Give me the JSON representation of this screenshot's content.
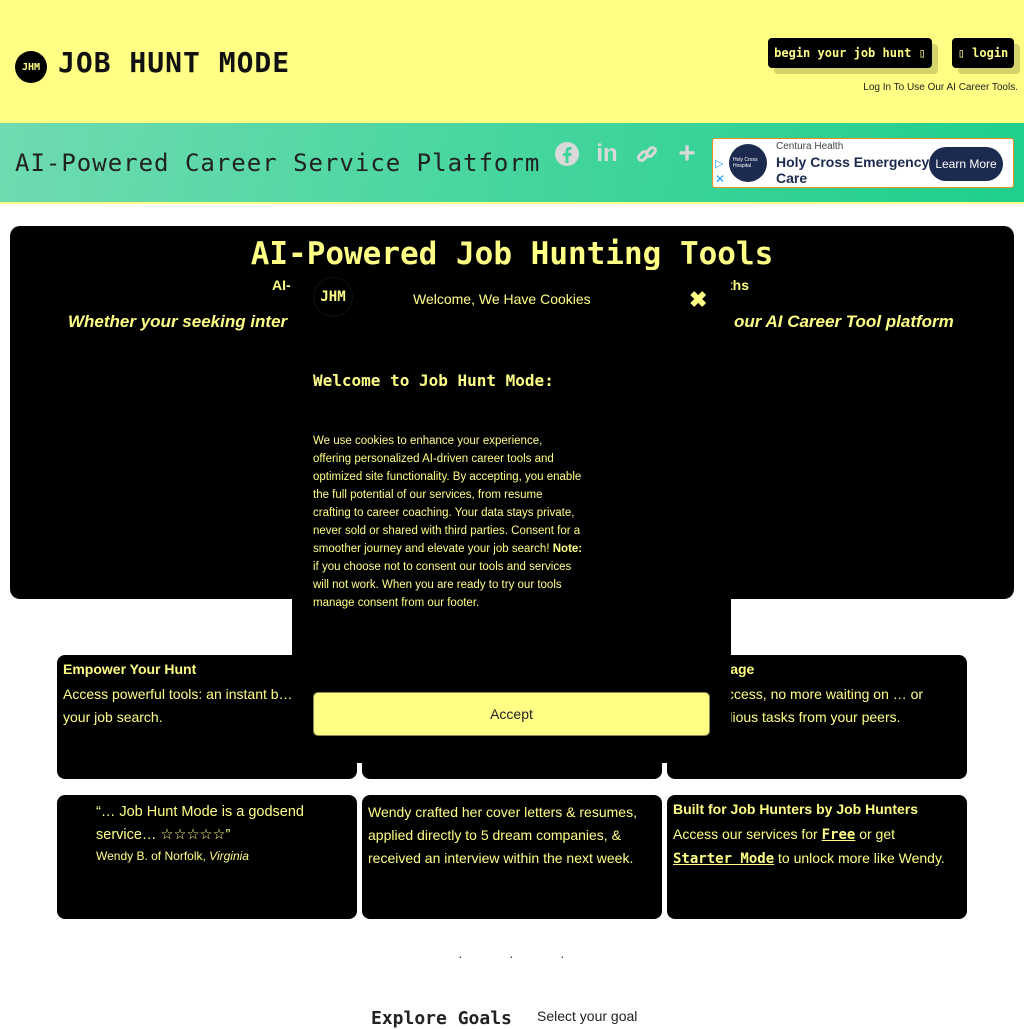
{
  "header": {
    "logo_text": "JHM",
    "brand": "JOB HUNT MODE",
    "begin_button": "begin your job hunt ▯",
    "login_button": "▯ login",
    "login_note": "Log In To Use Our AI Career Tools."
  },
  "banner": {
    "tagline": "AI-Powered Career Service Platform",
    "share_icons": [
      "facebook-icon",
      "linkedin-icon",
      "link-icon",
      "plus-icon"
    ]
  },
  "ad": {
    "logo_text": "Holy Cross Hospital",
    "sponsor": "Centura Health",
    "title": "Holy Cross Emergency Care",
    "cta": "Learn More",
    "play_icon": "▷",
    "close_icon": "✕"
  },
  "hero": {
    "title": "AI-Powered Job Hunting Tools",
    "subtitle_left": "AI-",
    "subtitle_right": "ths",
    "italic_left": "Whether your seeking inter",
    "italic_right": "our AI Career Tool platform"
  },
  "cards": [
    {
      "title": "Empower Your Hunt",
      "body": "Access powerful tools: an instant b… your job search."
    },
    {
      "title": "",
      "body": ""
    },
    {
      "title": "…ntage",
      "body": "…ccess, no more waiting on … or tedious tasks from your peers."
    },
    {
      "quote": "“… Job Hunt Mode is a godsend service… ☆☆☆☆☆”",
      "author": "Wendy B. of Norfolk,",
      "author_state": "Virginia"
    },
    {
      "body": "Wendy crafted her cover letters & resumes, applied directly to 5 dream companies, & received an interview within the next week."
    },
    {
      "title": "Built for Job Hunters by Job Hunters",
      "body_a": "Access our services for ",
      "link_free": "Free",
      "body_b": " or get ",
      "link_starter": "Starter Mode",
      "body_c": " to unlock more like Wendy."
    }
  ],
  "dots": [
    "·",
    "·",
    "·"
  ],
  "explore": {
    "title": "Explore Goals",
    "select_placeholder": "Select your goal"
  },
  "modal": {
    "logo_text": "JHM",
    "header": "Welcome, We Have Cookies",
    "close_icon": "✖",
    "title": "Welcome to Job Hunt Mode:",
    "body_a": "We use cookies to enhance your experience, offering personalized AI-driven career tools and optimized site functionality. By accepting, you enable the full potential of our services, from resume crafting to career coaching. Your data stays private, never sold or shared with third parties. Consent for a smoother journey and elevate your job search! ",
    "note_label": "Note:",
    "body_b": " if you choose not to consent our tools and services will not work. When you are ready to try our tools manage consent from our footer.",
    "accept_label": "Accept"
  },
  "colors": {
    "accent_yellow": "#ffff85",
    "banner_green": "#3ed49a",
    "ad_navy": "#1b2a4e"
  }
}
